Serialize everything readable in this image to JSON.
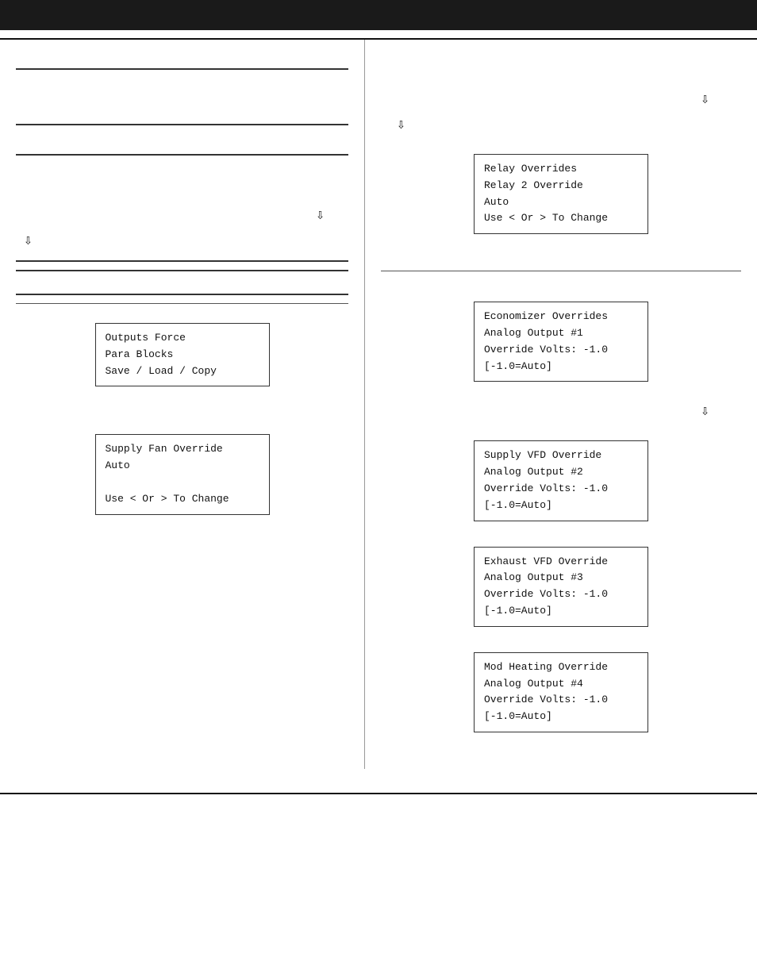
{
  "header": {
    "title": ""
  },
  "left": {
    "outputs_box": {
      "line1": "Outputs Force",
      "line2": "Para Blocks",
      "line3": "Save / Load / Copy"
    },
    "supply_fan_box": {
      "line1": "Supply Fan Override",
      "line2": "Auto",
      "line3": "",
      "line4": "Use < Or > To Change"
    }
  },
  "right": {
    "relay_box": {
      "line1": "Relay Overrides",
      "line2": "Relay 2 Override",
      "line3": "Auto",
      "line4": "Use < Or > To Change"
    },
    "economizer_box": {
      "line1": "Economizer Overrides",
      "line2": "  Analog Output #1",
      "line3": "Override Volts: -1.0",
      "line4": "     [-1.0=Auto]"
    },
    "supply_vfd_box": {
      "line1": "Supply VFD Override",
      "line2": "  Analog Output #2",
      "line3": "Override Volts: -1.0",
      "line4": "     [-1.0=Auto]"
    },
    "exhaust_vfd_box": {
      "line1": "Exhaust VFD Override",
      "line2": "  Analog Output #3",
      "line3": "Override Volts: -1.0",
      "line4": "     [-1.0=Auto]"
    },
    "mod_heating_box": {
      "line1": "Mod Heating Override",
      "line2": "  Analog Output #4",
      "line3": "Override Volts: -1.0",
      "line4": "     [-1.0=Auto]"
    }
  },
  "arrows": {
    "down": "⇩"
  }
}
